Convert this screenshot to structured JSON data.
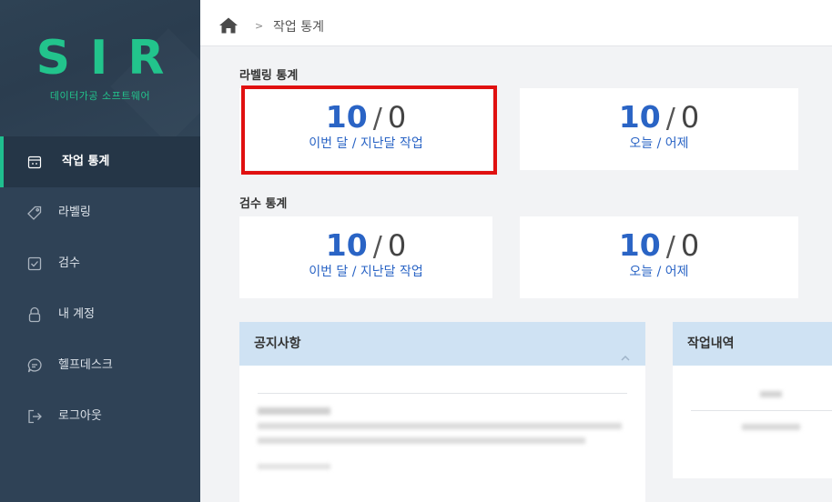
{
  "sidebar": {
    "logo": "SIR",
    "tagline": "데이터가공 소프트웨어",
    "items": [
      {
        "label": "작업 통계",
        "icon": "calendar-icon",
        "active": true
      },
      {
        "label": "라벨링",
        "icon": "tag-icon",
        "active": false
      },
      {
        "label": "검수",
        "icon": "check-square-icon",
        "active": false
      },
      {
        "label": "내 계정",
        "icon": "user-lock-icon",
        "active": false
      },
      {
        "label": "헬프데스크",
        "icon": "chat-bubble-icon",
        "active": false
      },
      {
        "label": "로그아웃",
        "icon": "logout-icon",
        "active": false
      }
    ]
  },
  "topbar": {
    "breadcrumb_sep": ">",
    "breadcrumb_current": "작업 통계"
  },
  "labeling_stats": {
    "title": "라벨링 통계",
    "monthly": {
      "current": "10",
      "slash": "/",
      "previous": "0",
      "label": "이번 달 / 지난달 작업"
    },
    "daily": {
      "current": "10",
      "slash": "/",
      "previous": "0",
      "label": "오늘 / 어제"
    }
  },
  "review_stats": {
    "title": "검수 통계",
    "monthly": {
      "current": "10",
      "slash": "/",
      "previous": "0",
      "label": "이번 달 / 지난달 작업"
    },
    "daily": {
      "current": "10",
      "slash": "/",
      "previous": "0",
      "label": "오늘 / 어제"
    }
  },
  "notice_panel": {
    "title": "공지사항"
  },
  "work_history_panel": {
    "title": "작업내역"
  },
  "colors": {
    "accent": "#22c48c",
    "sidebar_bg": "#2f4256",
    "stat_blue": "#2a64c5",
    "highlight_red": "#e01010",
    "panel_head": "#cfe2f3"
  }
}
